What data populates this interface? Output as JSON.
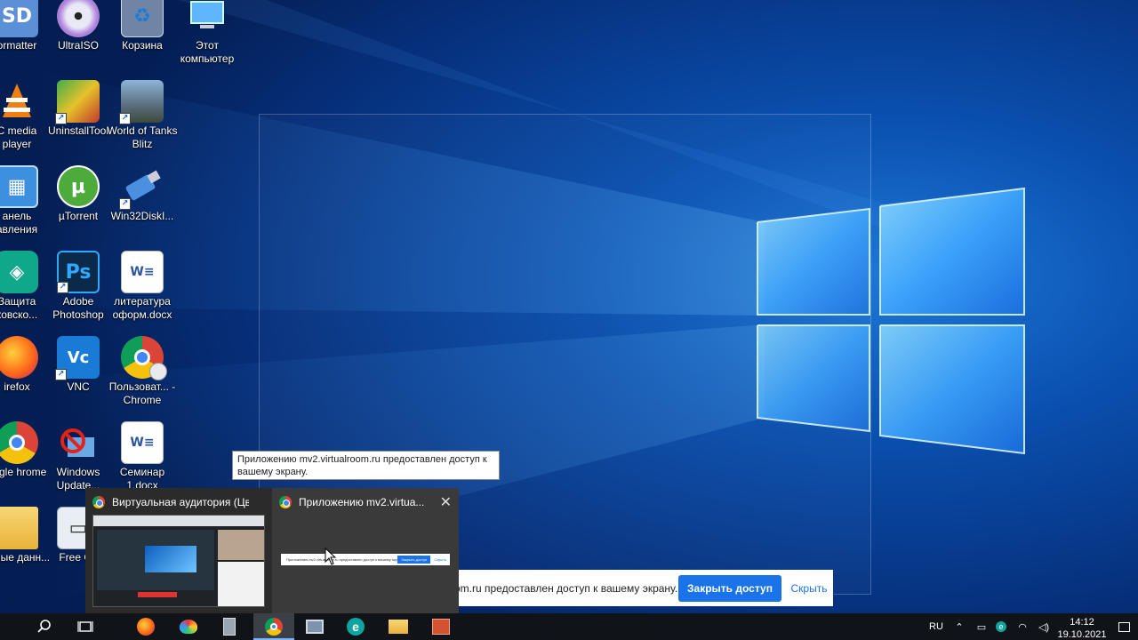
{
  "desktop": {
    "icons": [
      {
        "id": "formatter",
        "label": "ormatter",
        "icon": "sd-card-icon"
      },
      {
        "id": "ultraiso",
        "label": "UltraISO",
        "icon": "disc-icon"
      },
      {
        "id": "recycle",
        "label": "Корзина",
        "icon": "recycle-bin-icon"
      },
      {
        "id": "computer",
        "label": "Этот компьютер",
        "icon": "computer-icon"
      },
      {
        "id": "vlc",
        "label": "C media player",
        "icon": "vlc-cone-icon"
      },
      {
        "id": "uninstall",
        "label": "UninstallTool",
        "icon": "uninstall-tool-icon"
      },
      {
        "id": "wot",
        "label": "World of Tanks Blitz",
        "icon": "tank-game-icon"
      },
      {
        "id": "control",
        "label": "анель авления",
        "icon": "control-panel-icon"
      },
      {
        "id": "utorrent",
        "label": "µTorrent",
        "icon": "utorrent-icon"
      },
      {
        "id": "win32disk",
        "label": "Win32DiskI...",
        "icon": "usb-drive-icon"
      },
      {
        "id": "kaspersky",
        "label": "Защита ковско...",
        "icon": "security-shield-icon"
      },
      {
        "id": "photoshop",
        "label": "Adobe Photoshop",
        "icon": "photoshop-icon"
      },
      {
        "id": "literatura",
        "label": "литература оформ.docx",
        "icon": "word-document-icon"
      },
      {
        "id": "firefox",
        "label": "irefox",
        "icon": "firefox-icon"
      },
      {
        "id": "vnc",
        "label": "VNC",
        "icon": "vnc-icon"
      },
      {
        "id": "chrome-user",
        "label": "Пользоват... - Chrome",
        "icon": "chrome-user-icon"
      },
      {
        "id": "chrome",
        "label": "oogle hrome",
        "icon": "chrome-icon"
      },
      {
        "id": "winupdate",
        "label": "Windows Update...",
        "icon": "windows-update-icon"
      },
      {
        "id": "seminar",
        "label": "Семинар 1.docx",
        "icon": "word-document-icon"
      },
      {
        "id": "old-data",
        "label": "тарые данн...",
        "icon": "folder-icon"
      },
      {
        "id": "freecam",
        "label": "Free Ca",
        "icon": "free-cam-icon"
      }
    ]
  },
  "tooltip": {
    "text": "Приложению mv2.virtualroom.ru предоставлен доступ к вашему экрану."
  },
  "share_bar": {
    "text": "om.ru предоставлен доступ к вашему экрану.",
    "stop_label": "Закрыть доступ",
    "hide_label": "Скрыть"
  },
  "preview": {
    "windows": [
      {
        "title": "Виртуальная аудитория (Цвет...",
        "icon": "chrome-icon"
      },
      {
        "title": "Приложению mv2.virtua...",
        "icon": "chrome-icon"
      }
    ],
    "mini_share_text": "Приложению mv2.virtualroom.ru предоставлен доступ к вашему экрану",
    "mini_stop_label": "Закрыть доступ",
    "mini_hide_label": "Скрыть"
  },
  "taskbar": {
    "apps": [
      {
        "name": "search-icon"
      },
      {
        "name": "task-view-icon"
      },
      {
        "name": "firefox-icon"
      },
      {
        "name": "paint-icon"
      },
      {
        "name": "calculator-icon"
      },
      {
        "name": "chrome-icon"
      },
      {
        "name": "remote-desktop-icon"
      },
      {
        "name": "edge-icon"
      },
      {
        "name": "file-explorer-icon"
      },
      {
        "name": "presentation-icon"
      }
    ],
    "lang": "RU",
    "time": "14:12",
    "date": "19.10.2021"
  },
  "colors": {
    "accent": "#1a73e8",
    "taskbar": "#101318",
    "wallpaper_glow": "#6fc6ff"
  }
}
